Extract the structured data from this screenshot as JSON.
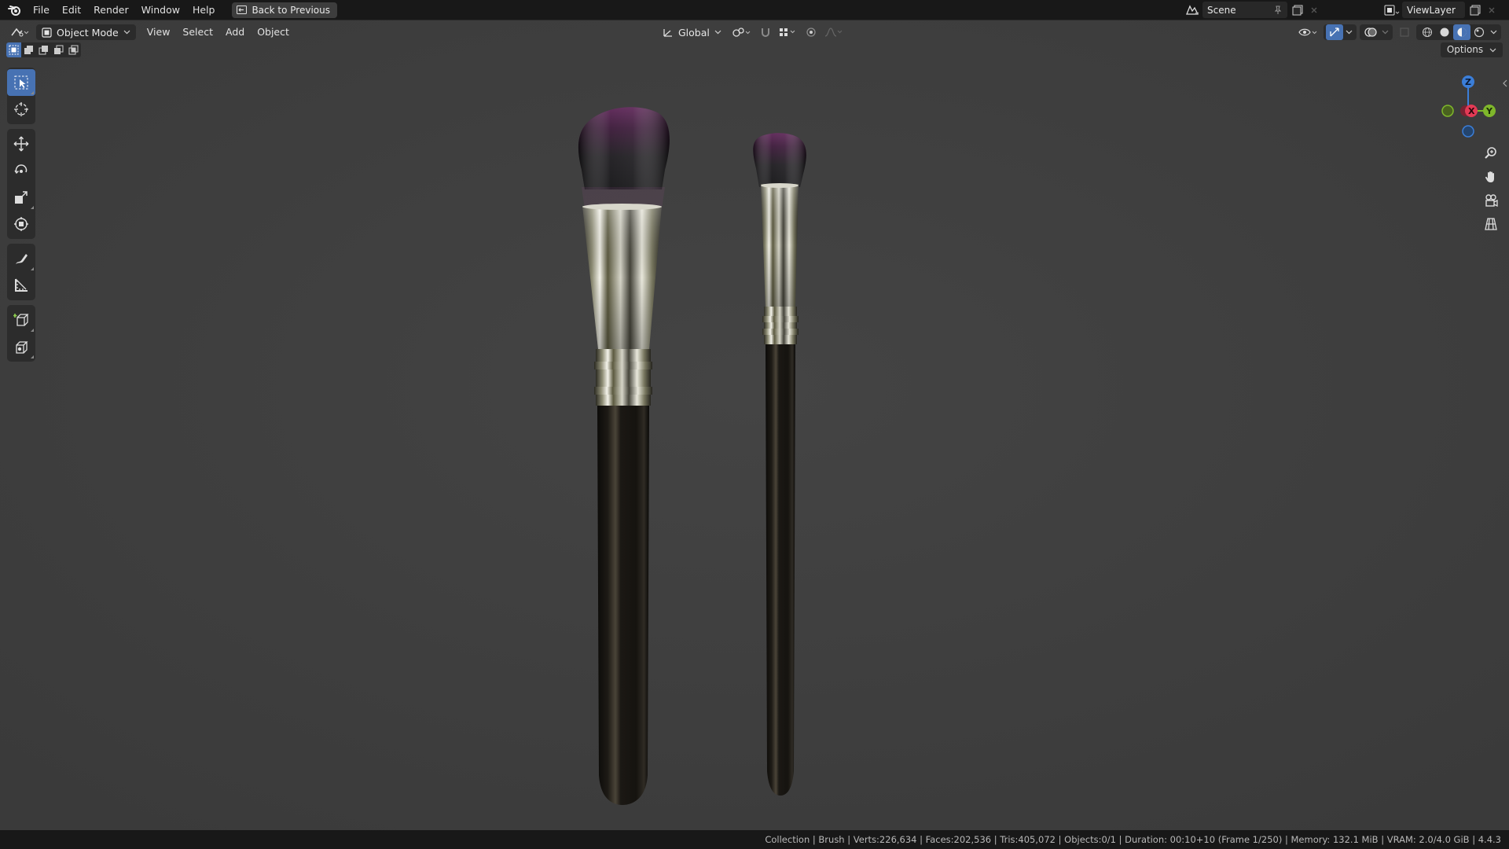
{
  "menubar": {
    "items": [
      "File",
      "Edit",
      "Render",
      "Window",
      "Help"
    ],
    "back_button": "Back to Previous",
    "scene": "Scene",
    "view_layer": "ViewLayer"
  },
  "viewport_header": {
    "mode": "Object Mode",
    "menus": [
      "View",
      "Select",
      "Add",
      "Object"
    ],
    "transform_orientation": "Global",
    "options_label": "Options"
  },
  "gizmo": {
    "x_label": "X",
    "y_label": "Y",
    "z_label": "Z",
    "colors": {
      "x": "#e33a55",
      "y": "#7fb72b",
      "z": "#3b7ed8"
    }
  },
  "objects": [
    {
      "name": "brush-large",
      "bristle_color": "#4a1d45",
      "ferrule": "chrome",
      "handle": "black"
    },
    {
      "name": "brush-small",
      "bristle_color": "#4a1d45",
      "ferrule": "chrome",
      "handle": "black"
    }
  ],
  "statusbar": {
    "text": "Collection | Brush | Verts:226,634 | Faces:202,536 | Tris:405,072 | Objects:0/1 | Duration: 00:10+10 (Frame 1/250) | Memory: 132.1 MiB | VRAM: 2.0/4.0 GiB | 4.4.3"
  },
  "colors": {
    "accent": "#4772b3",
    "viewport_bg": "#3f3f3f",
    "header_bg": "#181818"
  }
}
